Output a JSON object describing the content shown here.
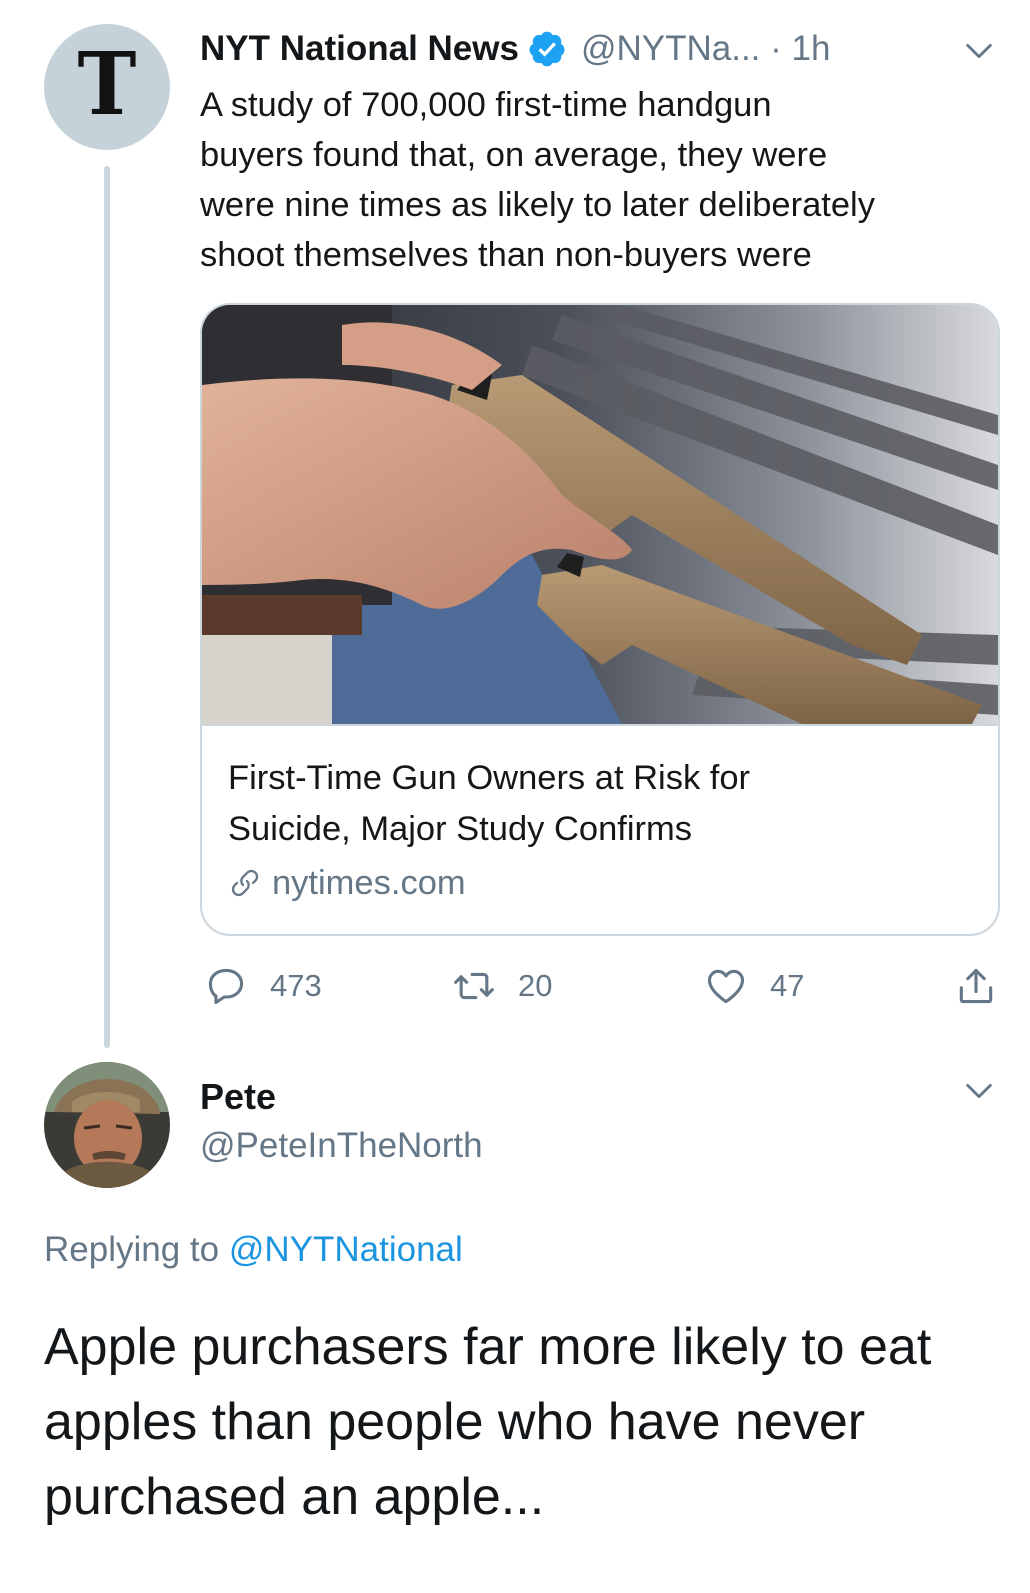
{
  "tweet": {
    "display_name": "NYT National News",
    "verified_icon": "verified-badge-icon",
    "handle": "@NYTNa...",
    "separator": "·",
    "time": "1h",
    "avatar_logo": "T",
    "text": "A study of 700,000 first-time handgun\nbuyers found that, on average, they were\nwere nine times as likely to later deliberately\nshoot themselves than non-buyers were",
    "card": {
      "title": "First-Time Gun Owners at Risk for\nSuicide, Major Study Confirms",
      "domain": "nytimes.com",
      "image_description": "Hand holding a tan handgun above a row of handguns on display"
    },
    "actions": {
      "replies": "473",
      "retweets": "20",
      "likes": "47"
    }
  },
  "reply": {
    "display_name": "Pete",
    "handle": "@PeteInTheNorth",
    "replying_prefix": "Replying to",
    "replying_to": "@NYTNational",
    "text": "Apple purchasers far more likely to eat\napples than people who have never\npurchased an apple..."
  },
  "colors": {
    "text_primary": "#14171a",
    "text_secondary": "#657786",
    "accent_blue": "#1da1f2",
    "mention_blue": "#1b95e0",
    "border": "#ccd6dd",
    "avatar_bg": "#c6d2da"
  }
}
